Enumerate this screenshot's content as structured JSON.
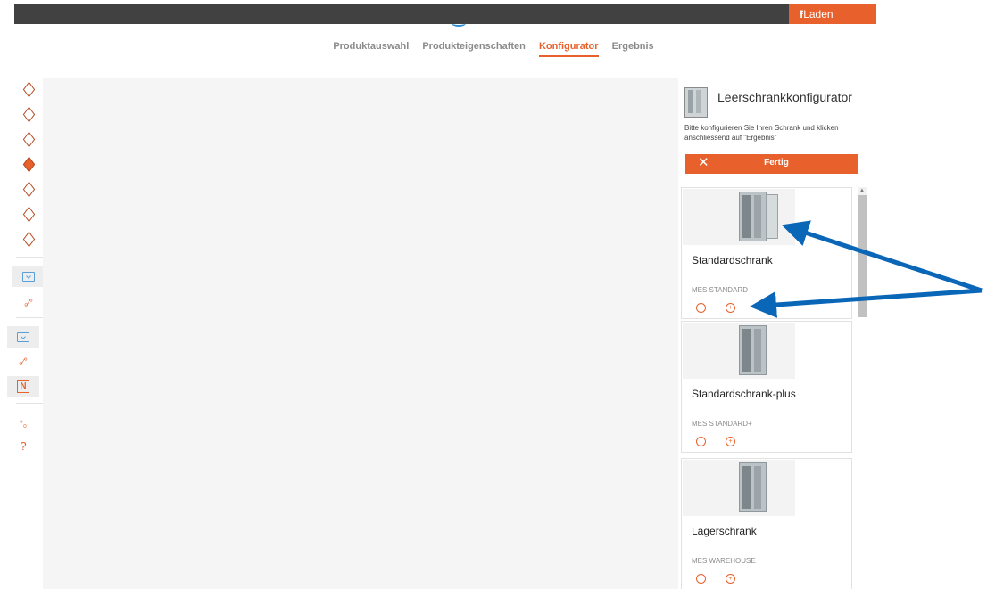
{
  "topbar": {
    "laden_label": "Laden"
  },
  "tabs": [
    {
      "label": "Produktauswahl",
      "active": false
    },
    {
      "label": "Produkteigenschaften",
      "active": false
    },
    {
      "label": "Konfigurator",
      "active": true
    },
    {
      "label": "Ergebnis",
      "active": false
    }
  ],
  "lefttools": {
    "icons": [
      "cube-front-icon",
      "cube-top-icon",
      "cube-back-icon",
      "cube-side-icon",
      "cube-left-icon",
      "cube-right-icon",
      "cube-iso-icon",
      "screen-select-icon",
      "route-icon",
      "screen-select-icon",
      "route-icon",
      "dimension-icon",
      "connection-icon",
      "help-icon"
    ],
    "help_glyph": "?"
  },
  "panel": {
    "title": "Leerschrankkonfigurator",
    "description": "Bitte konfigurieren Sie Ihren Schrank und klicken anschliessend auf \"Ergebnis\"",
    "fertig_label": "Fertig",
    "fertig_glyph": "✕",
    "products": [
      {
        "name": "Standardschrank",
        "code": "MES STANDARD"
      },
      {
        "name": "Standardschrank-plus",
        "code": "MES STANDARD+"
      },
      {
        "name": "Lagerschrank",
        "code": "MES WAREHOUSE"
      }
    ]
  },
  "colors": {
    "accent": "#e8612c",
    "topbar": "#414141",
    "annotation_arrow": "#0a66b7"
  }
}
